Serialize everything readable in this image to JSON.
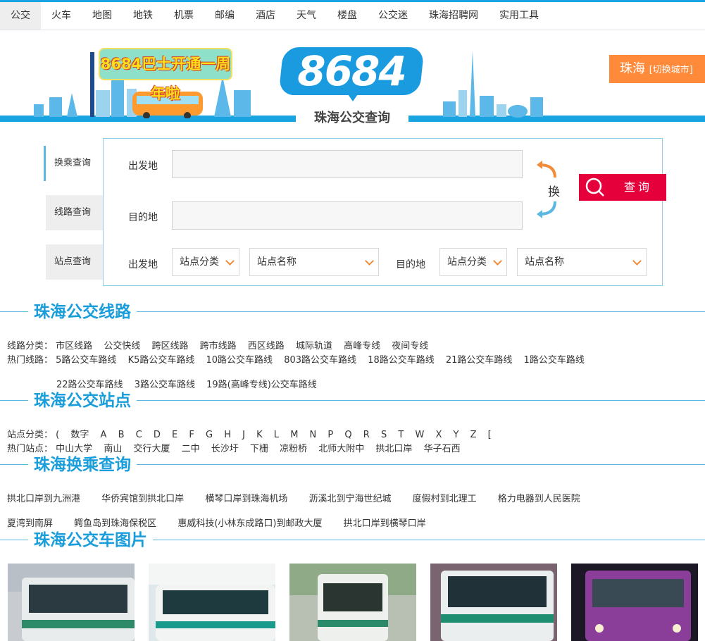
{
  "nav": [
    "公交",
    "火车",
    "地图",
    "地铁",
    "机票",
    "邮编",
    "酒店",
    "天气",
    "楼盘",
    "公交迷",
    "珠海招聘网",
    "实用工具"
  ],
  "banner": {
    "anniversary": "8684巴士开通一周年啦",
    "logo": "8684",
    "subtitle": "珠海公交查询",
    "city": "珠海",
    "switch_city": "[切换城市]"
  },
  "query": {
    "tabs": [
      "换乘查询",
      "线路查询",
      "站点查询"
    ],
    "from_label": "出发地",
    "to_label": "目的地",
    "swap_label": "换",
    "search_label": "查询",
    "stop_category": "站点分类",
    "stop_name": "站点名称"
  },
  "sections": {
    "lines": "珠海公交线路",
    "stops": "珠海公交站点",
    "transfers": "珠海换乘查询",
    "photos": "珠海公交车图片"
  },
  "lines": {
    "category_label": "线路分类：",
    "categories": [
      "市区线路",
      "公交快线",
      "跨区线路",
      "跨市线路",
      "西区线路",
      "城际轨道",
      "高峰专线",
      "夜间专线"
    ],
    "hot_label": "热门线路：",
    "hot_row1": [
      "5路公交车路线",
      "K5路公交车路线",
      "10路公交车路线",
      "803路公交车路线",
      "18路公交车路线",
      "21路公交车路线",
      "1路公交车路线"
    ],
    "hot_row2": [
      "22路公交车路线",
      "3路公交车路线",
      "19路(高峰专线)公交车路线"
    ]
  },
  "stops": {
    "category_label": "站点分类：",
    "letters": [
      "(",
      "数字",
      "A",
      "B",
      "C",
      "D",
      "E",
      "F",
      "G",
      "H",
      "J",
      "K",
      "L",
      "M",
      "N",
      "P",
      "Q",
      "R",
      "S",
      "T",
      "W",
      "X",
      "Y",
      "Z",
      "["
    ],
    "hot_label": "热门站点：",
    "hot": [
      "中山大学",
      "南山",
      "交行大厦",
      "二中",
      "长沙圩",
      "下栅",
      "凉粉桥",
      "北师大附中",
      "拱北口岸",
      "华子石西"
    ]
  },
  "transfers": {
    "row1": [
      "拱北口岸到九洲港",
      "华侨宾馆到拱北口岸",
      "横琴口岸到珠海机场",
      "沥溪北到宁海世纪城",
      "度假村到北理工",
      "格力电器到人民医院"
    ],
    "row2": [
      "夏湾到南屏",
      "鳄鱼岛到珠海保税区",
      "惠威科技(小林东成路口)到邮政大厦",
      "拱北口岸到横琴口岸"
    ]
  },
  "colors": {
    "brand_blue": "#19a3e0",
    "title_blue": "#199ddb",
    "search_red": "#e5003b",
    "city_orange": "#ff8a3a"
  }
}
